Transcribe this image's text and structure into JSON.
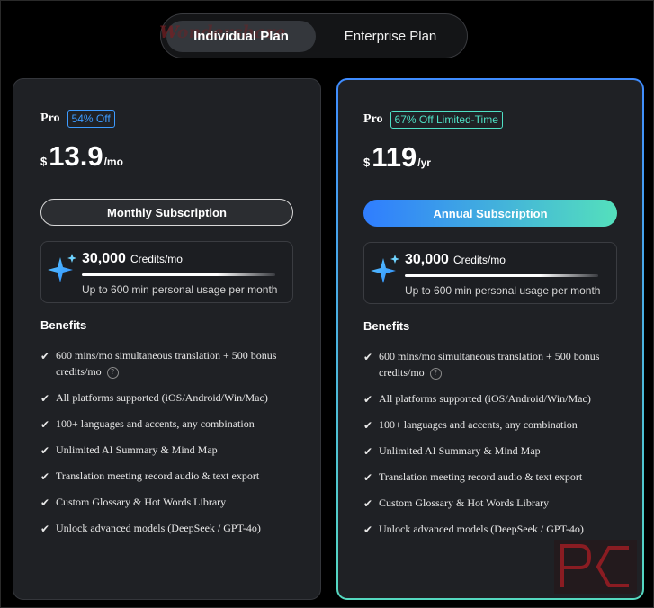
{
  "toggle": {
    "individual_label": "Individual Plan",
    "enterprise_label": "Enterprise Plan",
    "watermark_text": "Wondershare"
  },
  "plans": [
    {
      "name": "Pro",
      "badge": "54% Off",
      "currency": "$",
      "price": "13.9",
      "period": "/mo",
      "button_label": "Monthly Subscription",
      "credits_amount": "30,000",
      "credits_unit": "Credits/mo",
      "credits_note": "Up to 600 min personal usage per month",
      "benefits_title": "Benefits",
      "benefits": [
        "600 mins/mo simultaneous translation + 500 bonus credits/mo",
        "All platforms supported (iOS/Android/Win/Mac)",
        "100+ languages and accents, any combination",
        "Unlimited AI Summary & Mind Map",
        "Translation meeting record audio & text export",
        "Custom Glossary & Hot Words Library",
        "Unlock advanced models (DeepSeek / GPT-4o)"
      ]
    },
    {
      "name": "Pro",
      "badge": "67% Off Limited-Time",
      "currency": "$",
      "price": "119",
      "period": "/yr",
      "button_label": "Annual Subscription",
      "credits_amount": "30,000",
      "credits_unit": "Credits/mo",
      "credits_note": "Up to 600 min personal usage per month",
      "benefits_title": "Benefits",
      "benefits": [
        "600 mins/mo simultaneous translation + 500 bonus credits/mo",
        "All platforms supported (iOS/Android/Win/Mac)",
        "100+ languages and accents, any combination",
        "Unlimited AI Summary & Mind Map",
        "Translation meeting record audio & text export",
        "Custom Glossary & Hot Words Library",
        "Unlock advanced models (DeepSeek / GPT-4o)"
      ]
    }
  ],
  "icons": {
    "check": "✔",
    "help": "?"
  },
  "colors": {
    "accent_blue": "#3d9bff",
    "accent_teal": "#4fe0c5",
    "card_bg": "#1f2125"
  }
}
